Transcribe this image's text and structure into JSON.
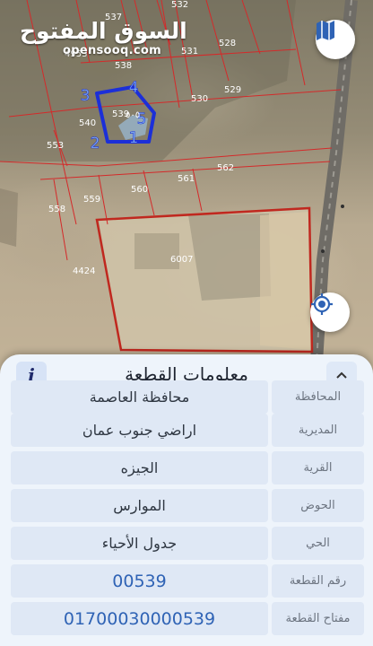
{
  "header": {
    "logo_text": "السوق المفتوح",
    "logo_subtext": "opensooq.com"
  },
  "map": {
    "parcel_numbers": [
      "537",
      "532",
      "4953",
      "528",
      "538",
      "531",
      "529",
      "530",
      "539",
      "540",
      "553",
      "562",
      "561",
      "560",
      "559",
      "558",
      "6007",
      "4424"
    ],
    "corner_markers": [
      "1",
      "2",
      "3",
      "4",
      "5"
    ],
    "parcel_tag": "٥٠٥",
    "controls": {
      "layers_icon": "map-icon",
      "locate_icon": "crosshair-icon"
    },
    "colors": {
      "boundary": "#d42a2a",
      "selected_parcel": "#1c2fd8",
      "marker": "#8fc1f2"
    }
  },
  "sheet": {
    "title": "معلومات القطعة",
    "info_icon_label": "i",
    "collapse_icon": "chevron-up-icon",
    "rows": [
      {
        "label": "المحافظة",
        "value": "محافظة العاصمة"
      },
      {
        "label": "المديرية",
        "value": "اراضي جنوب عمان"
      },
      {
        "label": "القرية",
        "value": "الجيزه"
      },
      {
        "label": "الحوض",
        "value": "الموارس"
      },
      {
        "label": "الحي",
        "value": "جدول الأحياء"
      },
      {
        "label": "رقم القطعة",
        "value": "00539"
      },
      {
        "label": "مفتاح القطعة",
        "value": "01700030000539"
      }
    ]
  }
}
